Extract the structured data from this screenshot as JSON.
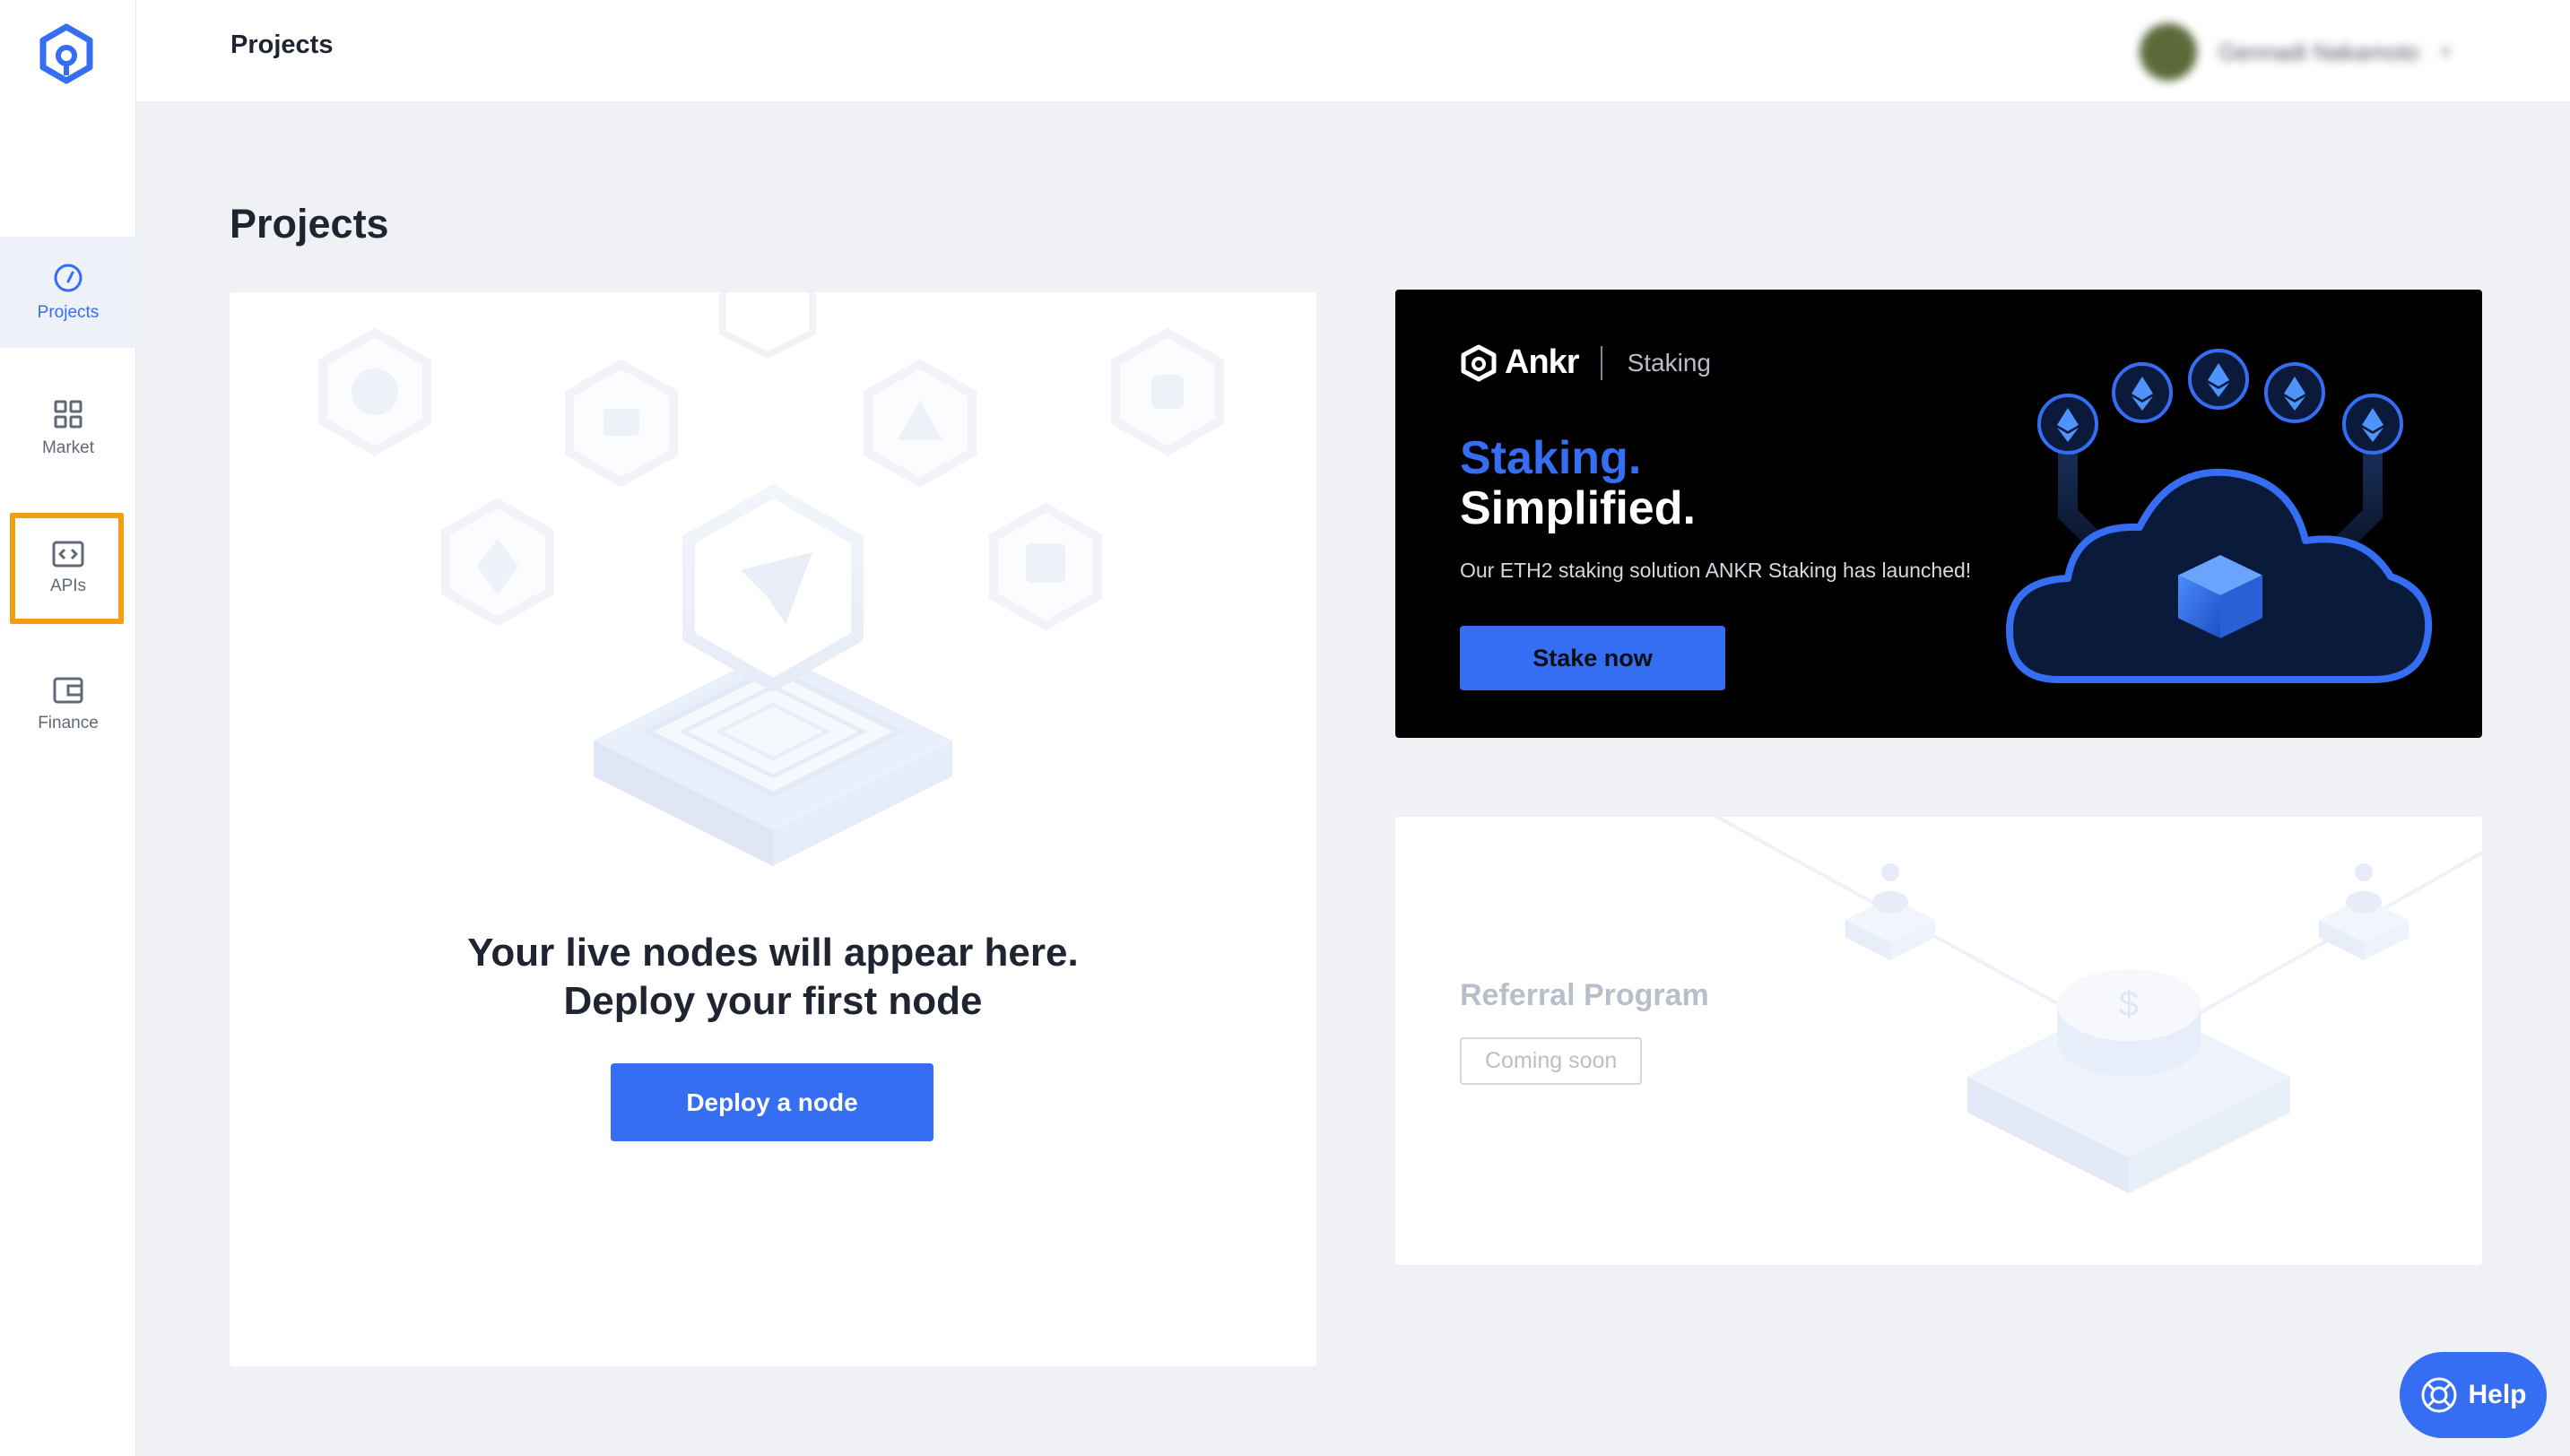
{
  "sidebar": {
    "logo": "ankr-logo-icon",
    "items": [
      {
        "label": "Projects",
        "icon": "gauge-icon",
        "active": true
      },
      {
        "label": "Market",
        "icon": "grid-icon",
        "active": false
      },
      {
        "label": "APIs",
        "icon": "code-icon",
        "active": false,
        "highlighted": true
      },
      {
        "label": "Finance",
        "icon": "wallet-icon",
        "active": false
      }
    ]
  },
  "topbar": {
    "title": "Projects",
    "user_name": "Gennadi Nakamoto"
  },
  "page": {
    "title": "Projects"
  },
  "empty_state": {
    "line1": "Your live nodes will appear here.",
    "line2": "Deploy your first node",
    "button": "Deploy a node"
  },
  "staking": {
    "brand": "Ankr",
    "brand_sub": "Staking",
    "headline1": "Staking.",
    "headline2": "Simplified.",
    "description": "Our ETH2 staking solution ANKR Staking has launched!",
    "button": "Stake now"
  },
  "referral": {
    "title": "Referral Program",
    "badge": "Coming soon"
  },
  "help": {
    "label": "Help"
  },
  "colors": {
    "accent": "#356df3",
    "highlight": "#f59d12",
    "background": "#eff1f5"
  }
}
